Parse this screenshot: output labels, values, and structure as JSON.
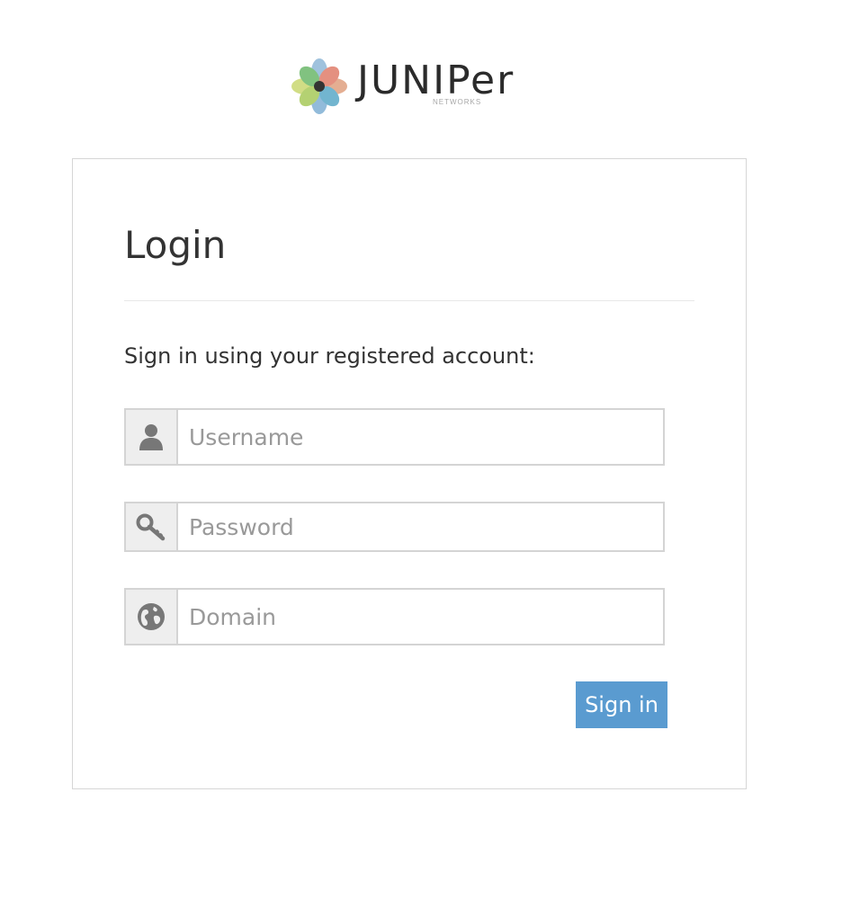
{
  "brand": {
    "wordmark": "JUNIPer",
    "sub": "NETWORKS"
  },
  "login": {
    "title": "Login",
    "subtitle": "Sign in using your registered account:",
    "username_placeholder": "Username",
    "password_placeholder": "Password",
    "domain_placeholder": "Domain",
    "signin_label": "Sign in"
  },
  "colors": {
    "button": "#5a9bd0",
    "addon_bg": "#eeeeee",
    "border": "#d4d4d4"
  },
  "icons": {
    "username": "user-icon",
    "password": "key-icon",
    "domain": "globe-icon"
  }
}
